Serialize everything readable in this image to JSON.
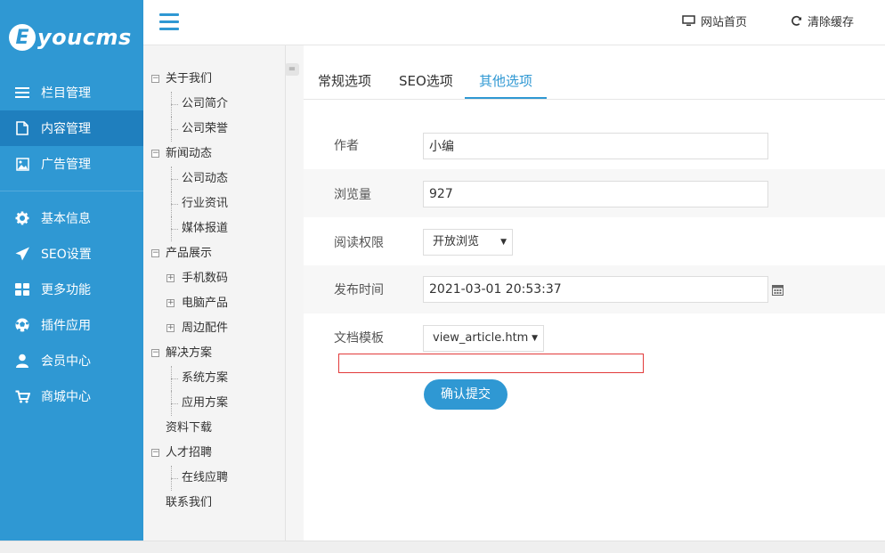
{
  "brand": {
    "badge": "E",
    "name": "youcms"
  },
  "sidebar": {
    "items": [
      {
        "label": "栏目管理",
        "icon": "list-icon"
      },
      {
        "label": "内容管理",
        "icon": "document-icon",
        "active": true
      },
      {
        "label": "广告管理",
        "icon": "image-icon"
      },
      {
        "label": "基本信息",
        "icon": "gear-icon"
      },
      {
        "label": "SEO设置",
        "icon": "paper-plane-icon"
      },
      {
        "label": "更多功能",
        "icon": "grid-icon"
      },
      {
        "label": "插件应用",
        "icon": "soccer-ball-icon"
      },
      {
        "label": "会员中心",
        "icon": "user-icon"
      },
      {
        "label": "商城中心",
        "icon": "cart-icon"
      }
    ]
  },
  "topbar": {
    "home_label": "网站首页",
    "clear_cache_label": "清除缓存"
  },
  "tree": [
    {
      "label": "关于我们",
      "level": 0,
      "toggle": "−"
    },
    {
      "label": "公司简介",
      "level": 1
    },
    {
      "label": "公司荣誉",
      "level": 1
    },
    {
      "label": "新闻动态",
      "level": 0,
      "toggle": "−"
    },
    {
      "label": "公司动态",
      "level": 1
    },
    {
      "label": "行业资讯",
      "level": 1
    },
    {
      "label": "媒体报道",
      "level": 1
    },
    {
      "label": "产品展示",
      "level": 0,
      "toggle": "−"
    },
    {
      "label": "手机数码",
      "level": 1,
      "toggle": "+"
    },
    {
      "label": "电脑产品",
      "level": 1,
      "toggle": "+"
    },
    {
      "label": "周边配件",
      "level": 1,
      "toggle": "+"
    },
    {
      "label": "解决方案",
      "level": 0,
      "toggle": "−"
    },
    {
      "label": "系统方案",
      "level": 1
    },
    {
      "label": "应用方案",
      "level": 1
    },
    {
      "label": "资料下载",
      "level": 0
    },
    {
      "label": "人才招聘",
      "level": 0,
      "toggle": "−"
    },
    {
      "label": "在线应聘",
      "level": 1
    },
    {
      "label": "联系我们",
      "level": 0
    }
  ],
  "tabs": [
    {
      "label": "常规选项"
    },
    {
      "label": "SEO选项"
    },
    {
      "label": "其他选项",
      "active": true
    }
  ],
  "form": {
    "author_label": "作者",
    "author_value": "小编",
    "views_label": "浏览量",
    "views_value": "927",
    "permission_label": "阅读权限",
    "permission_value": "开放浏览",
    "publish_label": "发布时间",
    "publish_value": "2021-03-01 20:53:37",
    "template_label": "文档模板",
    "template_value": "view_article.htm",
    "submit_label": "确认提交"
  },
  "colors": {
    "primary": "#2f98d3",
    "sidebar_active": "#1f7fbe",
    "error_border": "#e23b3b"
  }
}
